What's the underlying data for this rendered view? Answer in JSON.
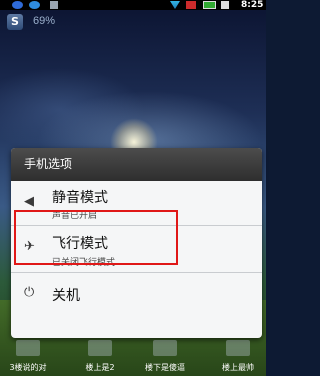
{
  "status_bar": {
    "time": "8:25",
    "icons": [
      "s-shield-icon",
      "qq-icon",
      "usb-icon",
      "wifi-icon",
      "signal-icon",
      "battery-icon",
      "alarm-icon"
    ]
  },
  "battery_widget": {
    "icon_letter": "S",
    "percent": "69%"
  },
  "dialog": {
    "title": "手机选项",
    "options": [
      {
        "icon": "speaker-icon",
        "icon_glyph": "◀",
        "title": "静音模式",
        "subtitle": "声音已开启"
      },
      {
        "icon": "airplane-icon",
        "icon_glyph": "✈",
        "title": "飞行模式",
        "subtitle": "已关闭飞行模式"
      },
      {
        "icon": "power-icon",
        "icon_glyph": "⏻",
        "title": "关机"
      }
    ],
    "highlight_color": "#e01818"
  },
  "dock": {
    "items": [
      "3楼说的对",
      "楼上是2",
      "楼下是傻逼",
      "楼上最帅"
    ]
  },
  "colors": {
    "dialog_header_bg": "#3a3a3a",
    "dialog_bg": "#f5f6f7"
  }
}
